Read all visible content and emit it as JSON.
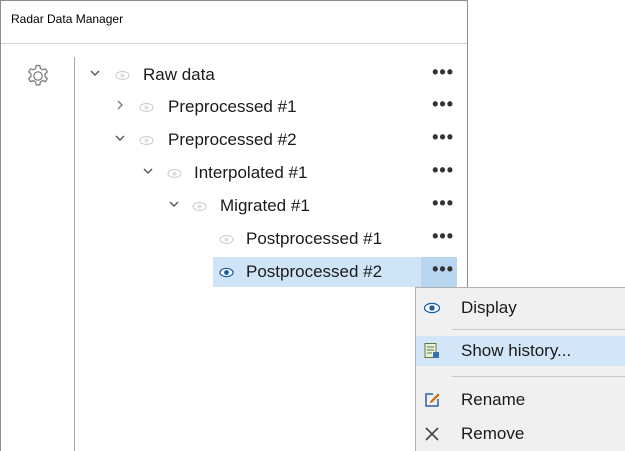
{
  "panel": {
    "title": "Radar Data Manager"
  },
  "tree": {
    "items": [
      {
        "label": "Raw data",
        "expanded": true,
        "visible": false
      },
      {
        "label": "Preprocessed #1",
        "expanded": false,
        "visible": false
      },
      {
        "label": "Preprocessed #2",
        "expanded": true,
        "visible": false
      },
      {
        "label": "Interpolated #1",
        "expanded": true,
        "visible": false
      },
      {
        "label": "Migrated #1",
        "expanded": true,
        "visible": false
      },
      {
        "label": "Postprocessed #1",
        "visible": false
      },
      {
        "label": "Postprocessed #2",
        "visible": true,
        "selected": true
      }
    ],
    "more_label": "•••"
  },
  "context_menu": {
    "items": [
      {
        "label": "Display",
        "icon": "eye-icon"
      },
      {
        "label": "Show history...",
        "icon": "history-icon",
        "highlighted": true
      },
      {
        "label": "Rename",
        "icon": "edit-icon"
      },
      {
        "label": "Remove",
        "icon": "close-icon"
      }
    ]
  },
  "colors": {
    "selection": "#cfe5f7",
    "menu_highlight": "#d2e6f8",
    "eye_active": "#1a5fa8",
    "eye_inactive": "#c8c8c8"
  }
}
